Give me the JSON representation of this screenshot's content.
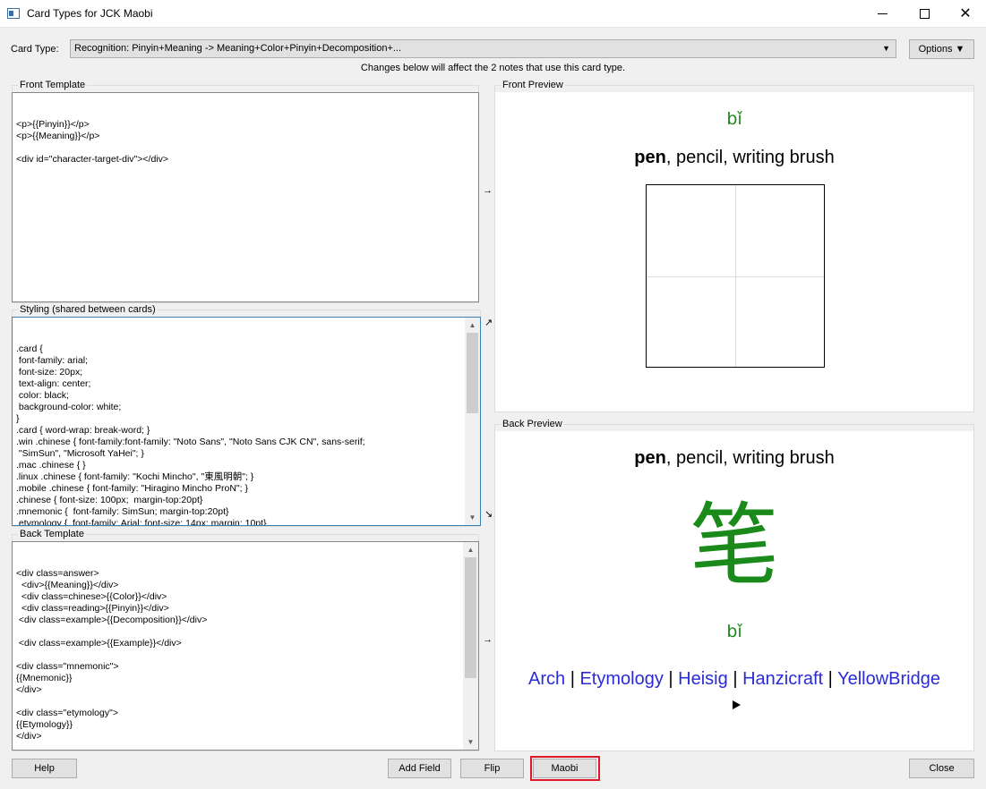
{
  "window": {
    "title": "Card Types for JCK Maobi",
    "minimize": "",
    "maximize": "",
    "close_glyph": "✕"
  },
  "card_type": {
    "label": "Card Type:",
    "selected": "Recognition: Pinyin+Meaning -> Meaning+Color+Pinyin+Decomposition+...",
    "dropdown_glyph": "▼",
    "options_button": "Options ▼"
  },
  "notice": "Changes below will affect the 2 notes that use this card type.",
  "front_template": {
    "label": "Front Template",
    "content": "<p>{{Pinyin}}</p>\n<p>{{Meaning}}</p>\n\n<div id=\"character-target-div\"></div>"
  },
  "styling": {
    "label": "Styling (shared between cards)",
    "content": ".card {\n font-family: arial;\n font-size: 20px;\n text-align: center;\n color: black;\n background-color: white;\n}\n.card { word-wrap: break-word; }\n.win .chinese { font-family:font-family: \"Noto Sans\", \"Noto Sans CJK CN\", sans-serif;\n \"SimSun\", \"Microsoft YaHei\"; }\n.mac .chinese { }\n.linux .chinese { font-family: \"Kochi Mincho\", \"東風明朝\"; }\n.mobile .chinese { font-family: \"Hiragino Mincho ProN\"; }\n.chinese { font-size: 100px;  margin-top:20pt}\n.mnemonic {  font-family: SimSun; margin-top:20pt}\n.etymology {  font-family: Arial; font-size: 14px; margin: 10pt}\n.example { font-size: 20px; font-family: \"Microsoft YaHei\"; margin-top:10pt}\n.reading { font-size: 25px;  ; margin-top:20pt}"
  },
  "back_template": {
    "label": "Back Template",
    "content": "<div class=answer>\n  <div>{{Meaning}}</div>\n  <div class=chinese>{{Color}}</div>\n  <div class=reading>{{Pinyin}}</div>\n <div class=example>{{Decomposition}}</div>\n\n <div class=example>{{Example}}</div>\n\n<div class=\"mnemonic\">\n{{Mnemonic}}\n</div>\n\n<div class=\"etymology\">\n{{Etymology}}\n</div>\n\n<div>\n<a href=\"http://www.archchinese.com/chinese_english_dictionary.html?find={{Hanzi}}\">Arch</a> |"
  },
  "arrows": {
    "front": "→",
    "styling_top": "↗",
    "styling_bottom": "↘",
    "back": "→"
  },
  "front_preview": {
    "label": "Front Preview",
    "pinyin": "bǐ",
    "meaning_bold": "pen",
    "meaning_rest": ", pencil, writing brush"
  },
  "back_preview": {
    "label": "Back Preview",
    "meaning_bold": "pen",
    "meaning_rest": ", pencil, writing brush",
    "hanzi": "笔",
    "pinyin": "bǐ",
    "links": [
      "Arch",
      "Etymology",
      "Heisig",
      "Hanzicraft",
      "YellowBridge"
    ],
    "separator": "|"
  },
  "buttons": {
    "help": "Help",
    "add_field": "Add Field",
    "flip": "Flip",
    "maobi": "Maobi",
    "close": "Close"
  },
  "colors": {
    "pinyin_green": "#1a8a1a",
    "link_blue": "#2b2bd6",
    "highlight_red": "#e0182a"
  }
}
